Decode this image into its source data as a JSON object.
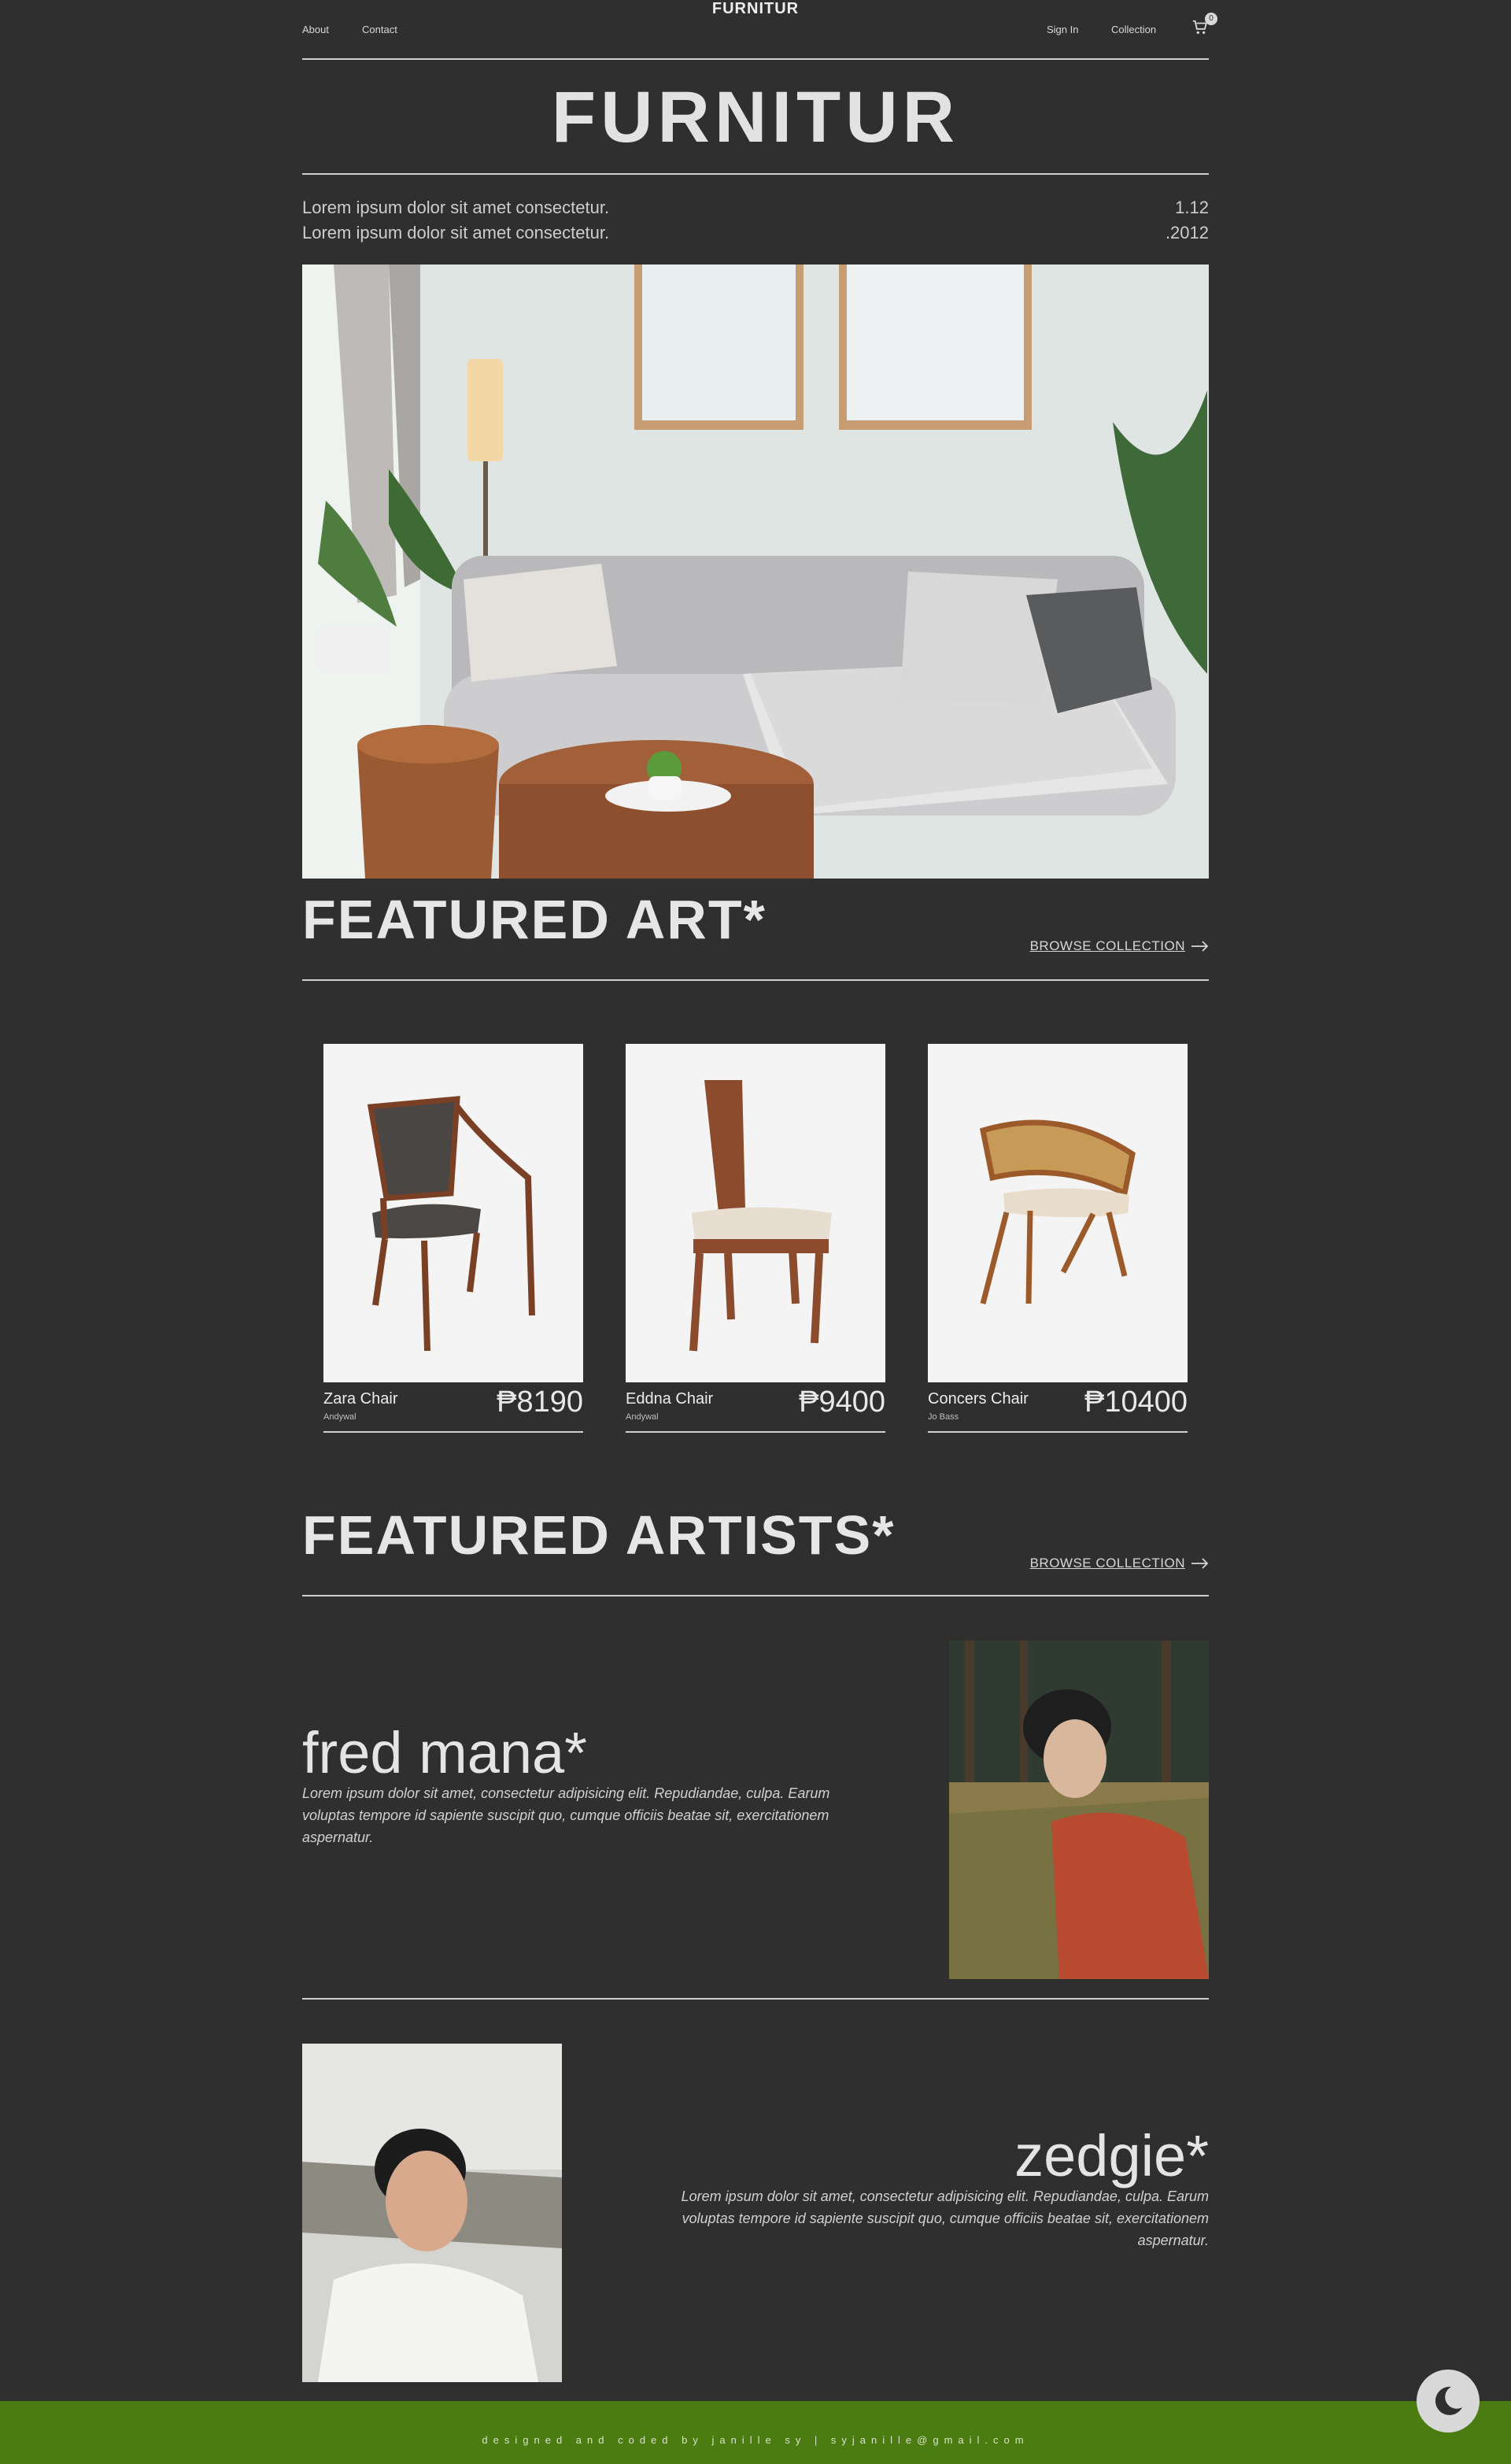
{
  "nav": {
    "about": "About",
    "contact": "Contact",
    "brand": "FURNITUR",
    "sign_in": "Sign In",
    "collection": "Collection",
    "cart_icon": "cart-icon",
    "cart_count": "0"
  },
  "hero": {
    "title": "FURNITUR",
    "line1": "Lorem ipsum dolor sit amet consectetur.",
    "line2": "Lorem ipsum dolor sit amet consectetur.",
    "num1": "1.12",
    "num2": ".2012"
  },
  "featured_art": {
    "heading": "FEATURED ART*",
    "browse": "BROWSE COLLECTION",
    "items": [
      {
        "name": "Zara Chair",
        "artist": "Andywal",
        "price": "₱8190"
      },
      {
        "name": "Eddna Chair",
        "artist": "Andywal",
        "price": "₱9400"
      },
      {
        "name": "Concers Chair",
        "artist": "Jo Bass",
        "price": "₱10400"
      }
    ]
  },
  "featured_artists": {
    "heading": "FEATURED ARTISTS*",
    "browse": "BROWSE COLLECTION",
    "artists": [
      {
        "name": "fred mana*",
        "desc": "Lorem ipsum dolor sit amet, consectetur adipisicing elit. Repudiandae, culpa. Earum voluptas tempore id sapiente suscipit quo, cumque officiis beatae sit, exercitationem aspernatur."
      },
      {
        "name": "zedgie*",
        "desc": "Lorem ipsum dolor sit amet, consectetur adipisicing elit. Repudiandae, culpa. Earum voluptas tempore id sapiente suscipit quo, cumque officiis beatae sit, exercitationem aspernatur."
      }
    ]
  },
  "footer": {
    "text": "designed and coded by janille sy | syjanille@gmail.com"
  },
  "colors": {
    "background": "#2f2f2f",
    "footer": "#4a7c12"
  }
}
